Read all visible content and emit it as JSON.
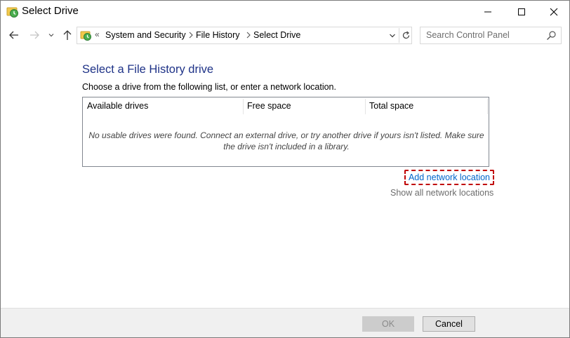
{
  "window": {
    "title": "Select Drive",
    "controls": [
      "minimize-icon",
      "maximize-icon",
      "close-icon"
    ]
  },
  "navigation": {
    "back_icon": "back-arrow-icon",
    "forward_icon": "forward-arrow-icon",
    "recent_icon": "chevron-down-icon",
    "up_icon": "up-arrow-icon",
    "address": {
      "overflow": "«",
      "crumbs": [
        "System and Security",
        "File History",
        "Select Drive"
      ]
    },
    "search": {
      "placeholder": "Search Control Panel"
    }
  },
  "main": {
    "heading": "Select a File History drive",
    "instruction": "Choose a drive from the following list, or enter a network location.",
    "drive_list": {
      "columns": [
        "Available drives",
        "Free space",
        "Total space"
      ],
      "rows": [],
      "empty_message": "No usable drives were found. Connect an external drive, or try another drive if yours isn't listed. Make sure the drive isn't included in a library."
    },
    "add_network_location": "Add network location",
    "show_all_network_locations": "Show all network locations"
  },
  "footer": {
    "ok_label": "OK",
    "ok_enabled": false,
    "cancel_label": "Cancel"
  },
  "colors": {
    "heading": "#1e3287",
    "link": "#0066cc",
    "highlight_border": "#c00000",
    "footer_bg": "#f0f0f0"
  }
}
